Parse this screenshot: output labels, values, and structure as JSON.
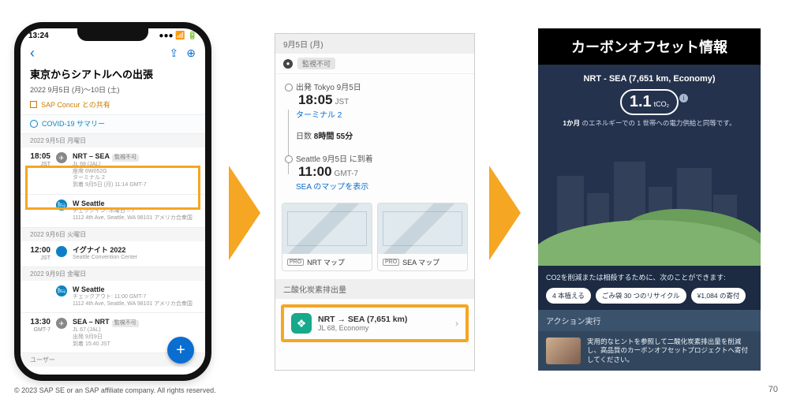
{
  "footer": {
    "copyright": "© 2023 SAP SE or an SAP affiliate company. All rights reserved.",
    "page": "70"
  },
  "phone": {
    "status_time": "13:24",
    "title": "東京からシアトルへの出張",
    "dates": "2022 9月5日 (月)〜10日 (土)",
    "concur": "SAP Concur との共有",
    "covid": "COVID-19 サマリー",
    "d1_header": "2022 9月5日 月曜日",
    "seg_flight1": {
      "time": "18:05",
      "tz": "JST",
      "title": "NRT – SEA",
      "tag": "監視不可",
      "l1": "JL 68 (JAL)",
      "l2": "座席 6W052G",
      "l3": "ターミナル 2",
      "l4": "到着 9月5日 (月) 11:14  GMT-7"
    },
    "seg_hotel1": {
      "title": "W Seattle",
      "l1": "チェックイン: 木曜日 – 7",
      "l2": "1112 4th Ave, Seattle, WA 98101 アメリカ合衆国"
    },
    "d2_header": "2022 9月6日 火曜日",
    "seg_event": {
      "time": "12:00",
      "tz": "JST",
      "title": "イグナイト 2022",
      "l1": "Seattle Convention Center"
    },
    "d3_header": "2022 9月9日 金曜日",
    "seg_hotel2": {
      "title": "W Seattle",
      "l1": "チェックアウト: 11:00 GMT-7",
      "l2": "1112 4th Ave, Seattle, WA 98101 アメリカ合衆国"
    },
    "seg_flight2": {
      "time": "13:30",
      "tz": "GMT-7",
      "title": "SEA – NRT",
      "tag": "監視不可",
      "l1": "JL 67 (JAL)",
      "l2": "出発 9月9日",
      "l3": "到着 15:40 JST"
    },
    "user_row": "ユーザー"
  },
  "detail": {
    "date_head": "9月5日 (月)",
    "watch_chip": "監視不可",
    "dep_label": "出発 Tokyo 9月5日",
    "dep_time": "18:05",
    "dep_tz": "JST",
    "terminal": "ターミナル 2",
    "dur_label": "日数",
    "dur_value": "8時間 55分",
    "arr_label": "Seattle 9月5日 に到着",
    "arr_time": "11:00",
    "arr_tz": "GMT-7",
    "sea_map_link": "SEA のマップを表示",
    "map1": "NRT マップ",
    "map2": "SEA マップ",
    "pro": "PRO",
    "co2_head": "二酸化炭素排出量",
    "co2_title": "NRT → SEA (7,651 km)",
    "co2_sub": "JL 68, Economy"
  },
  "offset": {
    "header": "カーボンオフセット情報",
    "route": "NRT - SEA  (7,651 km, Economy)",
    "value": "1.1",
    "unit": "tCO₂",
    "subline_a": "1か月",
    "subline_b": " のエネルギーでの 1 世帯への電力供給と同等です。",
    "strip_head": "CO2を削減または相殺するために、次のことができます:",
    "pill1": "4 本植える",
    "pill2": "ごみ袋 30 つのリサイクル",
    "pill3": "¥1,084 の寄付",
    "action_head": "アクション実行",
    "action_desc": "実用的なヒントを参照して二酸化炭素排出量を削減し、高品質のカーボンオフセットプロジェクトへ寄付してください。"
  }
}
